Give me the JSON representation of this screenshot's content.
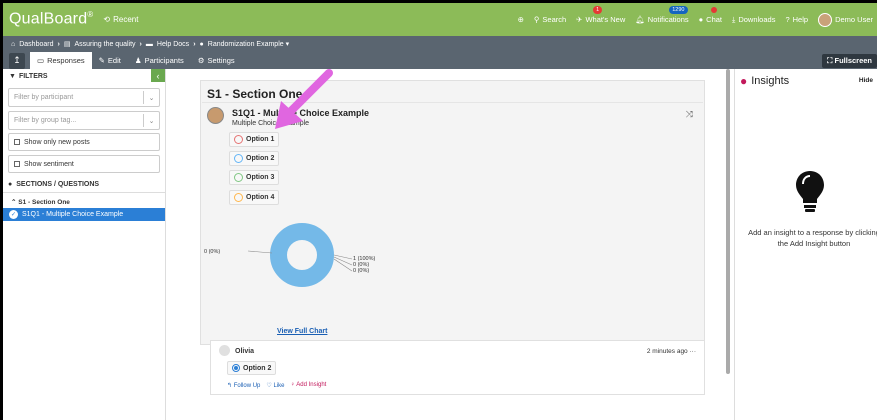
{
  "topbar": {
    "logo": "QualBoard",
    "logo_mark": "®",
    "recent": "Recent",
    "nav": [
      {
        "icon": "life-ring-icon",
        "label": ""
      },
      {
        "icon": "search-icon",
        "label": "Search"
      },
      {
        "icon": "megaphone-icon",
        "label": "What's New",
        "badge": "1"
      },
      {
        "icon": "bell-icon",
        "label": "Notifications",
        "badge": "1290"
      },
      {
        "icon": "chat-icon",
        "label": "Chat"
      },
      {
        "icon": "download-icon",
        "label": "Downloads"
      },
      {
        "icon": "help-icon",
        "label": "Help"
      },
      {
        "icon": "user-avatar",
        "label": "Demo User"
      }
    ]
  },
  "breadcrumb": [
    "Dashboard",
    "Assuring the quality",
    "Help Docs",
    "Randomization Example ▾"
  ],
  "tabs": {
    "responses": "Responses",
    "edit": "Edit",
    "participants": "Participants",
    "settings": "Settings",
    "fullscreen": "Fullscreen"
  },
  "left": {
    "filters_title": "FILTERS",
    "participant_placeholder": "Filter by participant",
    "group_placeholder": "Filter by group tag...",
    "new_posts": "Show only new posts",
    "sentiment": "Show sentiment",
    "sections_title": "SECTIONS / QUESTIONS",
    "section_item": "S1 - Section One",
    "question_item": "S1Q1 - Multiple Choice Example"
  },
  "main": {
    "section_title": "S1 - Section One",
    "question_title": "S1Q1 - Multiple Choice Example",
    "question_type": "Multiple Choice Example",
    "options": [
      {
        "label": "Option 1",
        "color": "#e57373"
      },
      {
        "label": "Option 2",
        "color": "#64b5f6"
      },
      {
        "label": "Option 3",
        "color": "#81c784"
      },
      {
        "label": "Option 4",
        "color": "#ffb74d"
      }
    ],
    "view_full_chart": "View Full Chart"
  },
  "chart_data": {
    "type": "pie",
    "categories": [
      "Option 1",
      "Option 2",
      "Option 3",
      "Option 4"
    ],
    "values": [
      0,
      1,
      0,
      0
    ],
    "labels": [
      "1 (100%)",
      "0 (0%)",
      "0 (0%)",
      "0 (0%)"
    ],
    "colors": {
      "primary": "#74b9e8"
    }
  },
  "response": {
    "name": "Olivia",
    "time": "2 minutes ago",
    "answer": "Option 2",
    "follow_up": "Follow Up",
    "like": "Like",
    "add_insight": "Add Insight",
    "more": "···"
  },
  "insights": {
    "title": "Insights",
    "hide": "Hide",
    "message": "Add an insight to a response by clicking the Add Insight button"
  },
  "colors": {
    "brand_green": "#8cbb58",
    "nav_gray": "#5a6570",
    "selected_blue": "#2b7fd6",
    "annotation_pink": "#e066e0"
  }
}
